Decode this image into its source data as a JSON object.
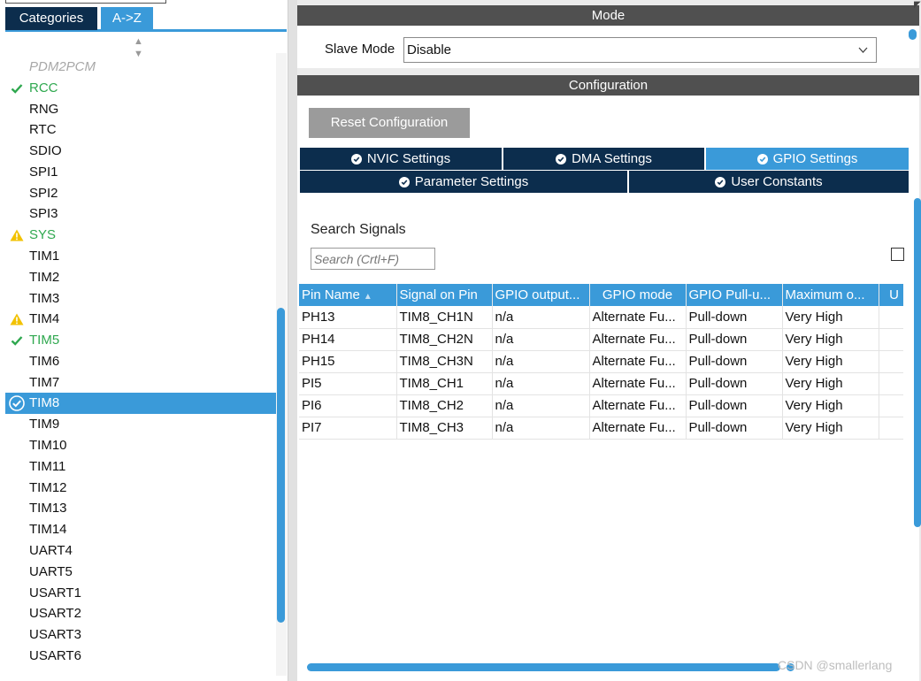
{
  "left_panel": {
    "tabs": {
      "categories": "Categories",
      "az": "A->Z"
    },
    "items": [
      {
        "label": "PDM2PCM",
        "state": "disabled"
      },
      {
        "label": "RCC",
        "state": "ok"
      },
      {
        "label": "RNG",
        "state": "normal"
      },
      {
        "label": "RTC",
        "state": "normal"
      },
      {
        "label": "SDIO",
        "state": "normal"
      },
      {
        "label": "SPI1",
        "state": "normal"
      },
      {
        "label": "SPI2",
        "state": "normal"
      },
      {
        "label": "SPI3",
        "state": "normal"
      },
      {
        "label": "SYS",
        "state": "warning"
      },
      {
        "label": "TIM1",
        "state": "normal"
      },
      {
        "label": "TIM2",
        "state": "normal"
      },
      {
        "label": "TIM3",
        "state": "normal"
      },
      {
        "label": "TIM4",
        "state": "warning-plain"
      },
      {
        "label": "TIM5",
        "state": "ok"
      },
      {
        "label": "TIM6",
        "state": "normal"
      },
      {
        "label": "TIM7",
        "state": "normal"
      },
      {
        "label": "TIM8",
        "state": "selected"
      },
      {
        "label": "TIM9",
        "state": "normal"
      },
      {
        "label": "TIM10",
        "state": "normal"
      },
      {
        "label": "TIM11",
        "state": "normal"
      },
      {
        "label": "TIM12",
        "state": "normal"
      },
      {
        "label": "TIM13",
        "state": "normal"
      },
      {
        "label": "TIM14",
        "state": "normal"
      },
      {
        "label": "UART4",
        "state": "normal"
      },
      {
        "label": "UART5",
        "state": "normal"
      },
      {
        "label": "USART1",
        "state": "normal"
      },
      {
        "label": "USART2",
        "state": "normal"
      },
      {
        "label": "USART3",
        "state": "normal"
      },
      {
        "label": "USART6",
        "state": "normal"
      }
    ]
  },
  "mode": {
    "title": "Mode",
    "slave_mode_label": "Slave Mode",
    "slave_mode_value": "Disable"
  },
  "configuration": {
    "title": "Configuration",
    "reset_label": "Reset Configuration",
    "tabs": {
      "nvic": "NVIC Settings",
      "dma": "DMA Settings",
      "gpio": "GPIO Settings",
      "param": "Parameter Settings",
      "user": "User Constants"
    },
    "active_tab": "gpio",
    "search_label": "Search Signals",
    "search_placeholder": "Search (Crtl+F)",
    "table": {
      "headers": [
        "Pin Name",
        "Signal on Pin",
        "GPIO output...",
        "GPIO mode",
        "GPIO Pull-u...",
        "Maximum o...",
        "U"
      ],
      "rows": [
        [
          "PH13",
          "TIM8_CH1N",
          "n/a",
          "Alternate Fu...",
          "Pull-down",
          "Very High",
          ""
        ],
        [
          "PH14",
          "TIM8_CH2N",
          "n/a",
          "Alternate Fu...",
          "Pull-down",
          "Very High",
          ""
        ],
        [
          "PH15",
          "TIM8_CH3N",
          "n/a",
          "Alternate Fu...",
          "Pull-down",
          "Very High",
          ""
        ],
        [
          "PI5",
          "TIM8_CH1",
          "n/a",
          "Alternate Fu...",
          "Pull-down",
          "Very High",
          ""
        ],
        [
          "PI6",
          "TIM8_CH2",
          "n/a",
          "Alternate Fu...",
          "Pull-down",
          "Very High",
          ""
        ],
        [
          "PI7",
          "TIM8_CH3",
          "n/a",
          "Alternate Fu...",
          "Pull-down",
          "Very High",
          ""
        ]
      ]
    }
  },
  "watermark": "CSDN @smallerlang",
  "colors": {
    "accent": "#3a9ad9",
    "navy": "#0c2d4d",
    "ok_green": "#2fa84f",
    "warning_yellow": "#f2c200",
    "header_gray": "#505050"
  },
  "icons": {
    "ok": "check-icon",
    "warning": "warning-icon",
    "selected": "check-circle-icon",
    "sort": "sort-icon",
    "dropdown": "chevron-down-icon"
  }
}
